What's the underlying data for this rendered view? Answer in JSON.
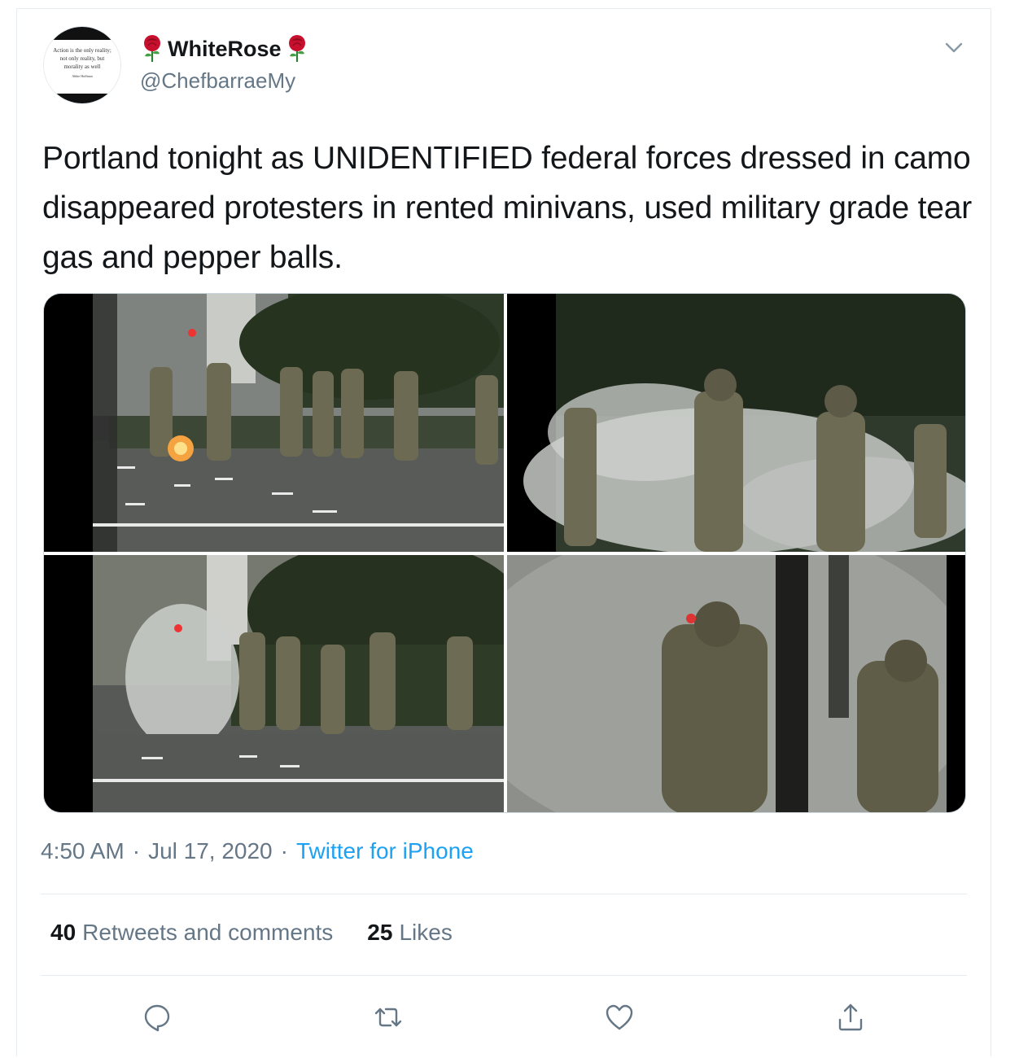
{
  "user": {
    "display_name": "WhiteRose",
    "handle": "@ChefbarraeMy",
    "avatar_quote": "Action is the only reality; not only reality, but morality as well",
    "avatar_attribution": "Abbie Hoffman"
  },
  "tweet": {
    "text": "Portland tonight as UNIDENTIFIED federal forces dressed in camo disappeared protesters in rented minivans, used military grade tear gas and pepper balls.",
    "time": "4:50 AM",
    "separator": "·",
    "date": "Jul 17, 2020",
    "source": "Twitter for iPhone"
  },
  "stats": {
    "retweets_count": "40",
    "retweets_label": "Retweets and comments",
    "likes_count": "25",
    "likes_label": "Likes"
  },
  "icons": {
    "more": "chevron-down-icon",
    "reply": "reply-icon",
    "retweet": "retweet-icon",
    "like": "heart-icon",
    "share": "share-icon",
    "rose": "rose-emoji-icon"
  },
  "colors": {
    "link": "#1da1f2",
    "secondary_text": "#657786",
    "rose_red": "#c8102e"
  },
  "media": {
    "count": 4
  }
}
